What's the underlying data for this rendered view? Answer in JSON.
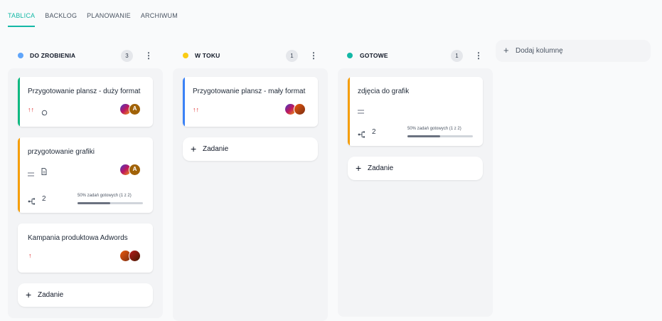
{
  "tabs": [
    {
      "label": "TABLICA",
      "active": true
    },
    {
      "label": "BACKLOG",
      "active": false
    },
    {
      "label": "PLANOWANIE",
      "active": false
    },
    {
      "label": "ARCHIWUM",
      "active": false
    }
  ],
  "colors": {
    "accent": "#14b8a6",
    "todo": "#60a5fa",
    "in_progress": "#facc15",
    "done": "#14b8a6",
    "card_green": "#10b981",
    "card_orange": "#f59e0b",
    "card_blue": "#3b82f6",
    "priority_red": "#dc2626"
  },
  "columns": [
    {
      "title": "DO ZROBIENIA",
      "count": "3",
      "cards": [
        {
          "title": "Przygotowanie plansz - duży format",
          "priority": "high-priority-icon",
          "icon": "comment-icon",
          "avatars": [
            "",
            "A"
          ]
        },
        {
          "title": "przygotowanie grafiki",
          "priority": "medium-priority-icon",
          "icon": "attachment-icon",
          "avatars": [
            "",
            "A"
          ],
          "subtask_count": "2",
          "progress_text": "50% zadań gotowych (1 z 2)",
          "progress": 0.5
        },
        {
          "title": "Kampania produktowa Adwords",
          "priority": "up-priority-icon",
          "avatars": [
            "",
            ""
          ]
        }
      ],
      "add_label": "Zadanie"
    },
    {
      "title": "W TOKU",
      "count": "1",
      "cards": [
        {
          "title": "Przygotowanie plansz - mały format",
          "priority": "high-priority-icon",
          "avatars": [
            "",
            ""
          ]
        }
      ],
      "add_label": "Zadanie"
    },
    {
      "title": "GOTOWE",
      "count": "1",
      "cards": [
        {
          "title": "zdjęcia do grafik",
          "priority": "medium-priority-icon",
          "subtask_count": "2",
          "progress_text": "50% zadań gotowych (1 z 2)",
          "progress": 0.5
        }
      ],
      "add_label": "Zadanie"
    }
  ],
  "add_column_label": "Dodaj kolumnę"
}
